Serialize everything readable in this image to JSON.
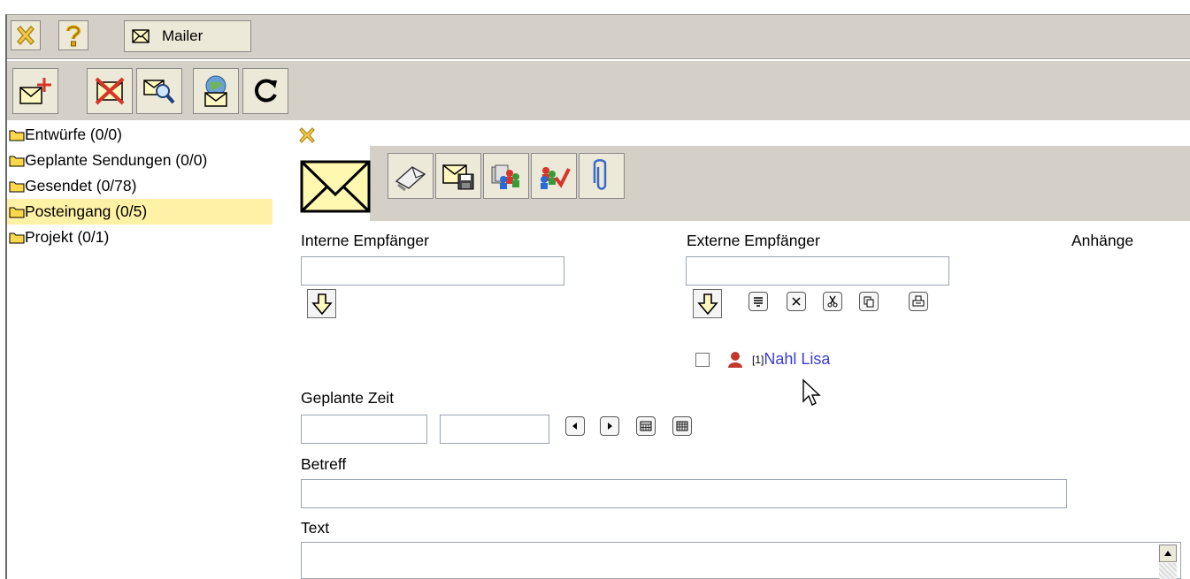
{
  "app": {
    "tab_label": "Mailer"
  },
  "titlebar": {
    "close_icon": "close-x-icon",
    "help_icon": "help-question-icon",
    "mail_icon": "envelope-icon"
  },
  "toolbar": {
    "buttons": [
      {
        "icon": "new-mail-icon"
      },
      {
        "icon": "delete-mail-icon"
      },
      {
        "icon": "search-mail-icon"
      },
      {
        "icon": "internet-mail-icon"
      },
      {
        "icon": "refresh-icon"
      }
    ]
  },
  "folders": [
    {
      "label": "Entwürfe (0/0)",
      "selected": false
    },
    {
      "label": "Geplante Sendungen (0/0)",
      "selected": false
    },
    {
      "label": "Gesendet (0/78)",
      "selected": false
    },
    {
      "label": "Posteingang (0/5)",
      "selected": true
    },
    {
      "label": "Projekt (0/1)",
      "selected": false
    }
  ],
  "compose": {
    "interne_label": "Interne Empfänger",
    "externe_label": "Externe Empfänger",
    "anhaenge_label": "Anhänge",
    "geplante_zeit_label": "Geplante Zeit",
    "betreff_label": "Betreff",
    "text_label": "Text",
    "interne_value": "",
    "externe_value": "",
    "date_value": "",
    "time_value": "",
    "betreff_value": "",
    "text_value": "",
    "recipient": {
      "count": "[1]",
      "name": "Nahl Lisa"
    }
  },
  "colors": {
    "bar_gray": "#d4d0c8",
    "selected_folder": "#fff2a6",
    "link_blue": "#3b3bd6"
  }
}
